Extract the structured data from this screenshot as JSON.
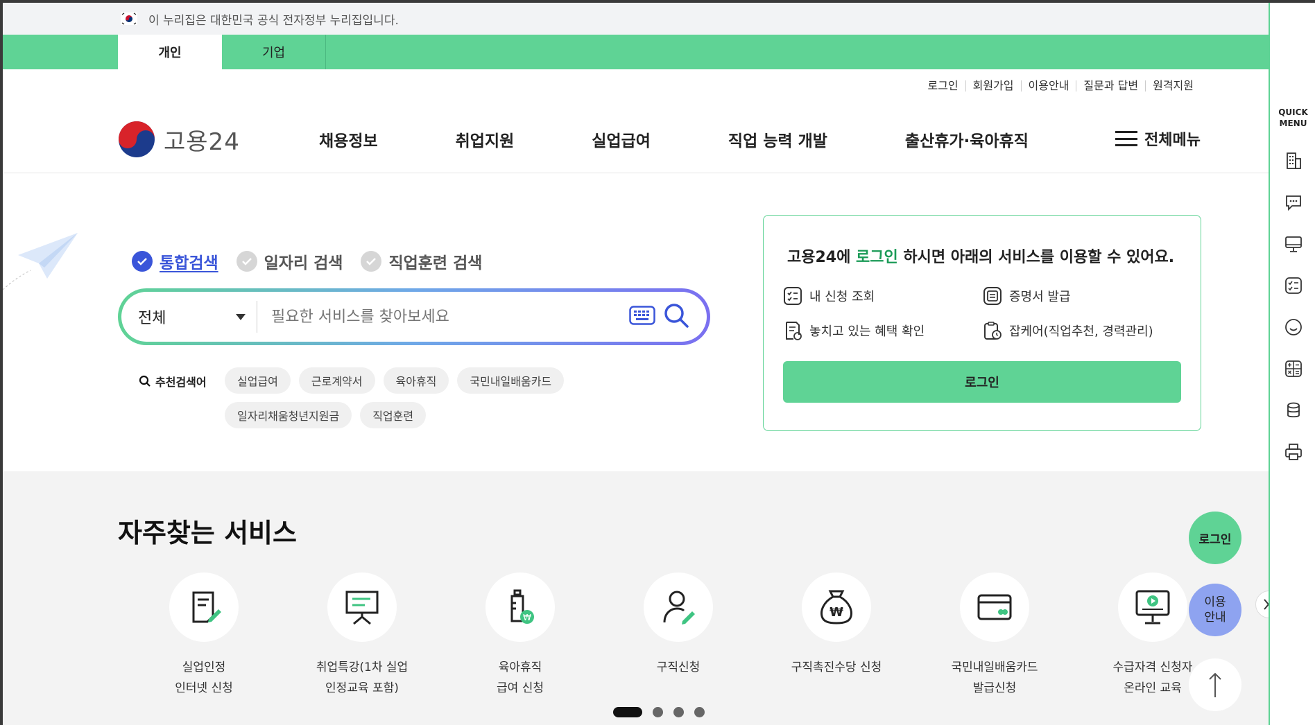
{
  "gov_banner": "이 누리집은 대한민국 공식 전자정부 누리집입니다.",
  "user_tabs": [
    "개인",
    "기업"
  ],
  "util_links": [
    "로그인",
    "회원가입",
    "이용안내",
    "질문과 답변",
    "원격지원"
  ],
  "logo_text": "고용24",
  "nav": [
    "채용정보",
    "취업지원",
    "실업급여",
    "직업 능력 개발",
    "출산휴가·육아휴직"
  ],
  "all_menu": "전체메뉴",
  "search": {
    "tabs": [
      "통합검색",
      "일자리 검색",
      "직업훈련 검색"
    ],
    "category": "전체",
    "placeholder": "필요한 서비스를 찾아보세요",
    "recommend_label": "추천검색어",
    "keywords": [
      "실업급여",
      "근로계약서",
      "육아휴직",
      "국민내일배움카드",
      "일자리채움청년지원금",
      "직업훈련"
    ]
  },
  "login_box": {
    "title_pre": "고용24에 ",
    "title_hl": "로그인",
    "title_post": " 하시면 아래의 서비스를 이용할 수 있어요.",
    "items": [
      "내 신청 조회",
      "증명서 발급",
      "놓치고 있는 혜택 확인",
      "잡케어(직업추천, 경력관리)"
    ],
    "button": "로그인"
  },
  "services": {
    "title": "자주찾는 서비스",
    "items": [
      {
        "label": "실업인정\n인터넷 신청",
        "icon": "document-edit-icon"
      },
      {
        "label": "취업특강(1차 실업\n인정교육 포함)",
        "icon": "presentation-board-icon"
      },
      {
        "label": "육아휴직\n급여 신청",
        "icon": "baby-bottle-icon"
      },
      {
        "label": "구직신청",
        "icon": "person-edit-icon"
      },
      {
        "label": "구직촉진수당 신청",
        "icon": "money-bag-icon"
      },
      {
        "label": "국민내일배움카드\n발급신청",
        "icon": "card-icon"
      },
      {
        "label": "수급자격 신청자\n온라인 교육",
        "icon": "monitor-play-icon"
      }
    ]
  },
  "floating": {
    "login": "로그인",
    "guide": "이용\n안내"
  },
  "quick_menu": {
    "title": "QUICK\nMENU"
  },
  "colors": {
    "brand_green": "#5fd395",
    "accent_blue": "#3a55d9"
  }
}
